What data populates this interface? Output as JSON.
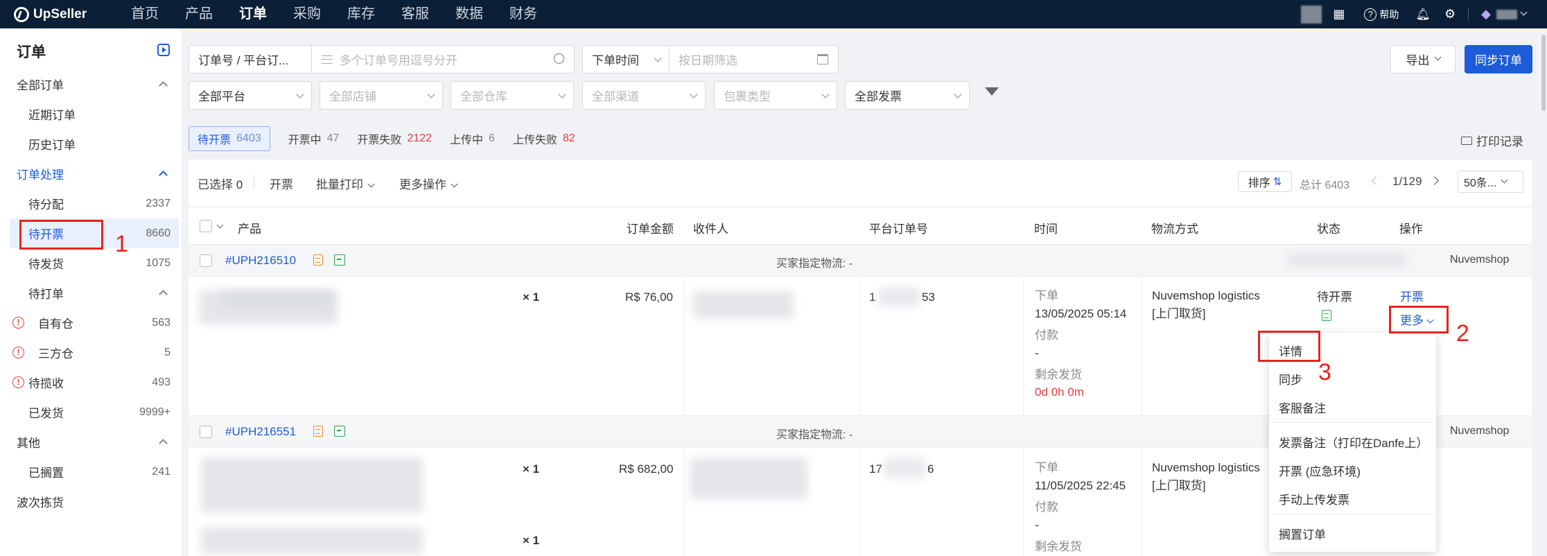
{
  "topnav": {
    "logo": "UpSeller",
    "items": [
      "首页",
      "产品",
      "订单",
      "采购",
      "库存",
      "客服",
      "数据",
      "财务"
    ],
    "help": "帮助"
  },
  "sidebar": {
    "title": "订单",
    "all_orders": "全部订单",
    "recent": "近期订单",
    "history": "历史订单",
    "processing": "订单处理",
    "to_assign": {
      "label": "待分配",
      "count": "2337"
    },
    "to_invoice": {
      "label": "待开票",
      "count": "8660"
    },
    "to_ship": {
      "label": "待发货",
      "count": "1075"
    },
    "to_print": "待打单",
    "own_wh": {
      "label": "自有仓",
      "count": "563"
    },
    "third_wh": {
      "label": "三方仓",
      "count": "5"
    },
    "to_collect": {
      "label": "待揽收",
      "count": "493"
    },
    "shipped": {
      "label": "已发货",
      "count": "9999+"
    },
    "other": "其他",
    "on_hold": {
      "label": "已搁置",
      "count": "241"
    },
    "wave": "波次拣货"
  },
  "filters": {
    "order_type": "订单号 / 平台订...",
    "search_placeholder": "多个订单号用逗号分开",
    "time_type": "下单时间",
    "date_placeholder": "按日期筛选",
    "platform": "全部平台",
    "store": "全部店铺",
    "warehouse": "全部仓库",
    "channel": "全部渠道",
    "package": "包裹类型",
    "invoice": "全部发票",
    "export": "导出",
    "sync": "同步订单"
  },
  "tabs": [
    {
      "label": "待开票",
      "count": "6403"
    },
    {
      "label": "开票中",
      "count": "47"
    },
    {
      "label": "开票失败",
      "count": "2122"
    },
    {
      "label": "上传中",
      "count": "6"
    },
    {
      "label": "上传失败",
      "count": "82"
    }
  ],
  "print_log": "打印记录",
  "toolbar": {
    "selected": "已选择",
    "selected_count": "0",
    "invoice": "开票",
    "batch_print": "批量打印",
    "more_ops": "更多操作",
    "sort": "排序",
    "total": "总计 6403",
    "page": "1/129",
    "page_size": "50条..."
  },
  "table_headers": {
    "product": "产品",
    "amount": "订单金额",
    "recipient": "收件人",
    "platform_no": "平台订单号",
    "time": "时间",
    "logistics": "物流方式",
    "status": "状态",
    "ops": "操作"
  },
  "orders": [
    {
      "no": "#UPH216510",
      "buyer_logistics": "买家指定物流: -",
      "platform": "Nuvemshop",
      "qty": "× 1",
      "amount": "R$ 76,00",
      "platform_no_a": "1",
      "platform_no_b": "53",
      "order_label": "下单",
      "order_time": "13/05/2025 05:14",
      "pay_label": "付款",
      "pay_time": "-",
      "remain_label": "剩余发货",
      "remain": "0d 0h 0m",
      "logistics": "Nuvemshop logistics",
      "pickup": "[上门取货]",
      "status": "待开票",
      "op_invoice": "开票",
      "op_more": "更多"
    },
    {
      "no": "#UPH216551",
      "buyer_logistics": "买家指定物流: -",
      "platform": "Nuvemshop",
      "qty": "× 1",
      "qty2": "× 1",
      "amount": "R$ 682,00",
      "platform_no_a": "17",
      "platform_no_b": "6",
      "order_label": "下单",
      "order_time": "11/05/2025 22:45",
      "pay_label": "付款",
      "pay_time": "-",
      "remain_label": "剩余发货",
      "logistics": "Nuvemshop logistics",
      "pickup": "[上门取货]"
    }
  ],
  "dropdown": [
    "详情",
    "同步",
    "客服备注",
    "发票备注（打印在Danfe上）",
    "开票 (应急环境)",
    "手动上传发票",
    "搁置订单"
  ],
  "annotations": [
    "1",
    "2",
    "3"
  ]
}
